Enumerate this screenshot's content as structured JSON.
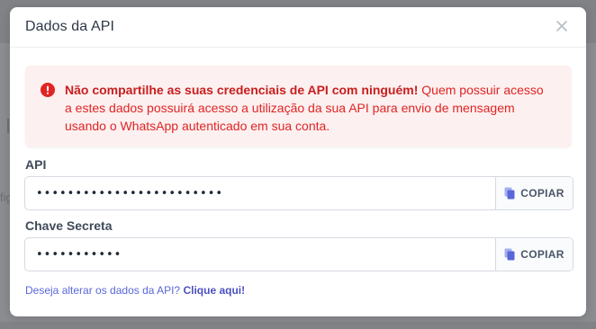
{
  "modal": {
    "title": "Dados da API"
  },
  "alert": {
    "bold_text": "Não compartilhe as suas credenciais de API com ninguém!",
    "text": " Quem possuir acesso a estes dados possuirá acesso a utilização da sua API para envio de mensagem usando o WhatsApp autenticado em sua conta."
  },
  "fields": {
    "api": {
      "label": "API",
      "value": "••••••••••••••••••••••••",
      "copy_label": "COPIAR"
    },
    "secret": {
      "label": "Chave Secreta",
      "value": "•••••••••••",
      "copy_label": "COPIAR"
    }
  },
  "footer": {
    "question": "Deseja alterar os dados da API?",
    "link": "Clique aqui!"
  },
  "background": {
    "stub_text": "fig"
  },
  "colors": {
    "danger": "#e02424",
    "danger_bg": "#fdf0f0",
    "link": "#4c51bf",
    "copy_icon": "#5a67d8"
  }
}
